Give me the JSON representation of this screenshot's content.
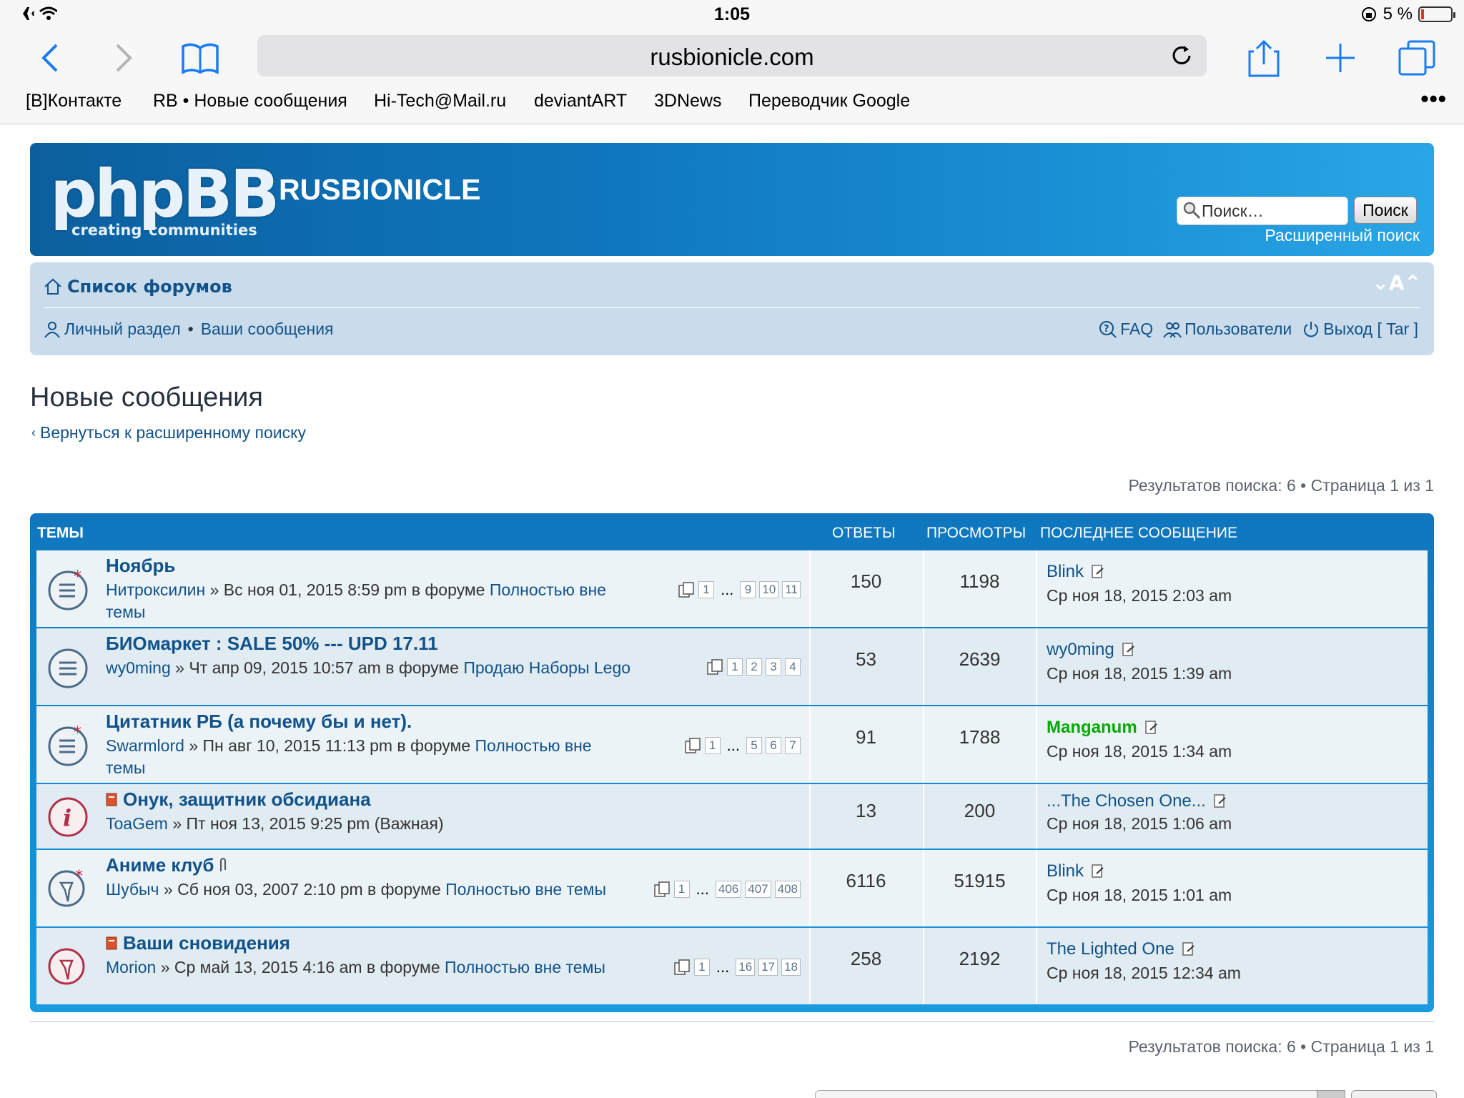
{
  "status_bar": {
    "time": "1:05",
    "battery": "5 %"
  },
  "browser": {
    "url": "rusbionicle.com",
    "bookmarks": [
      "[B]Контакте",
      "RB • Новые сообщения",
      "Hi-Tech@Mail.ru",
      "deviantART",
      "3DNews",
      "Переводчик Google"
    ],
    "more": "•••"
  },
  "header": {
    "logo_text": "phpBB",
    "logo_sub1": "creating",
    "logo_sub2": "communities",
    "site_title": "RUSBIONICLE",
    "search_placeholder": "Поиск…",
    "search_button": "Поиск",
    "advanced_search": "Расширенный поиск"
  },
  "nav": {
    "forum_index": "Список форумов",
    "font_size": "⌄A⌃",
    "personal": "Личный раздел",
    "my_posts": "Ваши сообщения",
    "faq": "FAQ",
    "members": "Пользователи",
    "logout": "Выход [ Tar ]"
  },
  "page": {
    "title": "Новые сообщения",
    "back_link": "Вернуться к расширенному поиску",
    "result_info": "Результатов поиска: 6 • Страница 1 из 1"
  },
  "table": {
    "headers": {
      "topics": "ТЕМЫ",
      "replies": "ОТВЕТЫ",
      "views": "ПРОСМОТРЫ",
      "last_post": "ПОСЛЕДНЕЕ СООБЩЕНИЕ"
    },
    "rows": [
      {
        "title": "Ноябрь",
        "author": "Нитроксилин",
        "date": "» Вс ноя 01, 2015 8:59 pm в форуме",
        "forum": "Полностью вне темы",
        "pages": [
          "1",
          "...",
          "9",
          "10",
          "11"
        ],
        "replies": "150",
        "views": "1198",
        "last_author": "Blink",
        "last_date": "Ср ноя 18, 2015 2:03 am"
      },
      {
        "title": "БИОмаркет : SALE 50% --- UPD 17.11",
        "author": "wy0ming",
        "date": "» Чт апр 09, 2015 10:57 am в форуме",
        "forum": "Продаю Наборы Lego",
        "pages": [
          "1",
          "2",
          "3",
          "4"
        ],
        "replies": "53",
        "views": "2639",
        "last_author": "wy0ming",
        "last_date": "Ср ноя 18, 2015 1:39 am"
      },
      {
        "title": "Цитатник РБ (а почему бы и нет).",
        "author": "Swarmlord",
        "date": "» Пн авг 10, 2015 11:13 pm в форуме",
        "forum": "Полностью вне темы",
        "pages": [
          "1",
          "...",
          "5",
          "6",
          "7"
        ],
        "replies": "91",
        "views": "1788",
        "last_author": "Manganum",
        "last_date": "Ср ноя 18, 2015 1:34 am"
      },
      {
        "title": "Онук, защитник обсидиана",
        "author": "ToaGem",
        "date": "» Пт ноя 13, 2015 9:25 pm (Важная)",
        "forum": "",
        "pages": [],
        "replies": "13",
        "views": "200",
        "last_author": "...The Chosen One...",
        "last_date": "Ср ноя 18, 2015 1:06 am"
      },
      {
        "title": "Аниме клуб",
        "author": "Шубыч",
        "date": "» Сб ноя 03, 2007 2:10 pm в форуме",
        "forum": "Полностью вне темы",
        "pages": [
          "1",
          "...",
          "406",
          "407",
          "408"
        ],
        "replies": "6116",
        "views": "51915",
        "last_author": "Blink",
        "last_date": "Ср ноя 18, 2015 1:01 am"
      },
      {
        "title": "Ваши сновидения",
        "author": "Morion",
        "date": "» Ср май 13, 2015 4:16 am в форуме",
        "forum": "Полностью вне темы",
        "pages": [
          "1",
          "...",
          "16",
          "17",
          "18"
        ],
        "replies": "258",
        "views": "2192",
        "last_author": "The Lighted One",
        "last_date": "Ср ноя 18, 2015 12:34 am"
      }
    ]
  },
  "colors": {
    "link": "#105289",
    "header_blue": "#0f76bd",
    "nav_bg": "#cadceb",
    "row_bg": "#ecf3f7",
    "row_alt": "#e1ebf2",
    "manganum": "#00aa00"
  }
}
